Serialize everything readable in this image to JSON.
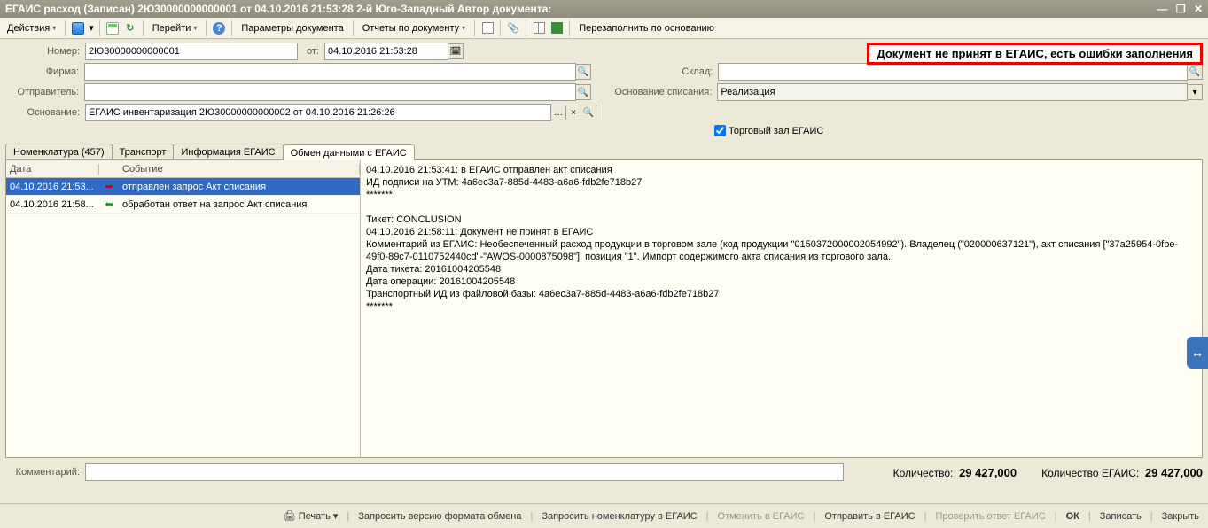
{
  "title": "ЕГАИС расход (Записан)  2Ю30000000000001 от 04.10.2016 21:53:28 2-й Юго-Западный Автор документа:",
  "toolbar": {
    "actions": "Действия",
    "goto": "Перейти",
    "params": "Параметры документа",
    "reports": "Отчеты по документу",
    "refill": "Перезаполнить по основанию"
  },
  "error_banner": "Документ не принят в ЕГАИС, есть ошибки заполнения",
  "form": {
    "number_lbl": "Номер:",
    "number": "2Ю30000000000001",
    "from_lbl": "от:",
    "from": "04.10.2016 21:53:28",
    "firm_lbl": "Фирма:",
    "firm": "",
    "sender_lbl": "Отправитель:",
    "sender": "",
    "basis_lbl": "Основание:",
    "basis": "ЕГАИС инвентаризация 2Ю30000000000002 от 04.10.2016 21:26:26",
    "warehouse_lbl": "Склад:",
    "warehouse": "",
    "reason_lbl": "Основание списания:",
    "reason": "Реализация",
    "trade_hall_chk": "Торговый зал ЕГАИС"
  },
  "tabs": {
    "t0": "Номенклатура (457)",
    "t1": "Транспорт",
    "t2": "Информация ЕГАИС",
    "t3": "Обмен данными с ЕГАИС"
  },
  "events": {
    "h_date": "Дата",
    "h_event": "Событие",
    "rows": [
      {
        "date": "04.10.2016 21:53...",
        "dir": "out",
        "ev": "отправлен запрос Акт списания"
      },
      {
        "date": "04.10.2016 21:58...",
        "dir": "in",
        "ev": "обработан ответ на запрос Акт списания"
      }
    ]
  },
  "details_text": "04.10.2016 21:53:41: в ЕГАИС отправлен акт списания\nИД подписи на УТМ: 4a6ec3a7-885d-4483-a6a6-fdb2fe718b27\n*******\n\nТикет: CONCLUSION\n04.10.2016 21:58:11: Документ не принят в ЕГАИС\nКомментарий из ЕГАИС: Необеспеченный расход продукции в торговом зале (код продукции \"0150372000002054992\"). Владелец (\"020000637121\"), акт списания [\"37a25954-0fbe-49f0-89c7-0110752440cd\"-\"AWOS-0000875098\"], позиция \"1\". Импорт содержимого акта списания из торгового зала.\nДата тикета: 20161004205548\nДата операции: 20161004205548\nТранспортный ИД из файловой базы: 4a6ec3a7-885d-4483-a6a6-fdb2fe718b27\n*******",
  "comment_lbl": "Комментарий:",
  "comment": "",
  "summary": {
    "qty_lbl": "Количество:",
    "qty": "29 427,000",
    "qty_egais_lbl": "Количество ЕГАИС:",
    "qty_egais": "29 427,000"
  },
  "bottom": {
    "print": "Печать",
    "req_ver": "Запросить версию формата обмена",
    "req_nom": "Запросить номенклатуру в ЕГАИС",
    "cancel_eg": "Отменить в ЕГАИС",
    "send_eg": "Отправить в ЕГАИС",
    "check_eg": "Проверить ответ ЕГАИС",
    "ok": "ОК",
    "save": "Записать",
    "close": "Закрыть"
  }
}
